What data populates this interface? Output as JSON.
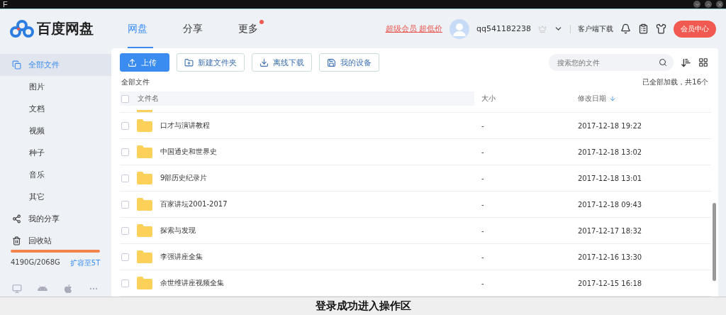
{
  "titlebar": {
    "letter": "F"
  },
  "app": {
    "name": "百度网盘"
  },
  "tabs": [
    {
      "label": "网盘",
      "selected": true,
      "badge": false
    },
    {
      "label": "分享",
      "selected": false,
      "badge": false
    },
    {
      "label": "更多",
      "selected": false,
      "badge": true
    }
  ],
  "header": {
    "promo": "超级会员 超低价",
    "username": "qq541182238",
    "client_download": "客户端下载",
    "vip_button": "会员中心"
  },
  "sidebar": {
    "items": [
      {
        "label": "全部文件",
        "kind": "main",
        "selected": true
      },
      {
        "label": "图片",
        "kind": "sub",
        "selected": false
      },
      {
        "label": "文档",
        "kind": "sub",
        "selected": false
      },
      {
        "label": "视频",
        "kind": "sub",
        "selected": false
      },
      {
        "label": "种子",
        "kind": "sub",
        "selected": false
      },
      {
        "label": "音乐",
        "kind": "sub",
        "selected": false
      },
      {
        "label": "其它",
        "kind": "sub",
        "selected": false
      },
      {
        "label": "我的分享",
        "kind": "share",
        "selected": false
      },
      {
        "label": "回收站",
        "kind": "trash",
        "selected": false
      }
    ],
    "storage": "4190G/2068G",
    "expand_link": "扩容至5T"
  },
  "toolbar": {
    "buttons": [
      {
        "label": "上传",
        "kind": "upload"
      },
      {
        "label": "新建文件夹",
        "kind": "newfolder"
      },
      {
        "label": "离线下载",
        "kind": "download"
      },
      {
        "label": "我的设备",
        "kind": "device"
      }
    ],
    "search": {
      "placeholder": "搜索您的文件"
    }
  },
  "breadcrumb": "全部文件",
  "load_status": "已全部加载，共16个",
  "table": {
    "columns": [
      "文件名",
      "大小",
      "修改日期"
    ],
    "all_checked": false,
    "rows": [
      {
        "name": "口才与演讲教程",
        "size": "-",
        "date": "2017-12-18 19:22",
        "checked": false
      },
      {
        "name": "中国通史和世界史",
        "size": "-",
        "date": "2017-12-18 13:02",
        "checked": false
      },
      {
        "name": "9部历史纪录片",
        "size": "-",
        "date": "2017-12-18 13:01",
        "checked": false
      },
      {
        "name": "百家讲坛2001-2017",
        "size": "-",
        "date": "2017-12-18 09:43",
        "checked": false
      },
      {
        "name": "探索与发现",
        "size": "-",
        "date": "2017-12-17 18:32",
        "checked": false
      },
      {
        "name": "李强讲座全集",
        "size": "-",
        "date": "2017-12-16 13:30",
        "checked": false
      },
      {
        "name": "余世维讲座视频全集",
        "size": "-",
        "date": "2017-12-15 16:18",
        "checked": false
      }
    ]
  },
  "caption": "登录成功进入操作区"
}
